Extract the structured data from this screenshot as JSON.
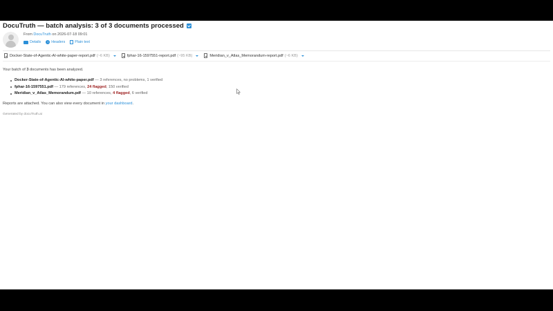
{
  "email": {
    "subject": "DocuTruth — batch analysis: 3 of 3 documents processed",
    "from_prefix": "From",
    "sender": "DocuTruth",
    "date_text": "on 2026-07-18 09:01",
    "meta_links": {
      "details": "Details",
      "headers": "Headers",
      "plain_text": "Plain text"
    },
    "attachments": [
      {
        "name": "Docker-State-of-Agentic-AI-white-paper-report.pdf",
        "size": "(~6 KB)"
      },
      {
        "name": "fphar-16-1597551-report.pdf",
        "size": "(~95 KB)"
      },
      {
        "name": "Meridian_v_Atlas_Memorandum-report.pdf",
        "size": "(~6 KB)"
      }
    ],
    "intro_pre": "Your batch of",
    "intro_count": "3",
    "intro_post": "documents has been analyzed.",
    "results": [
      {
        "file": "Docker-State-of-Agentic-AI-white-paper.pdf",
        "summary": "— 3 references, no problems, 1 verified",
        "flagged": "",
        "after": ""
      },
      {
        "file": "fphar-16-1597551.pdf",
        "summary": "— 179 references,",
        "flagged": "24 flagged",
        "after": ", 150 verified"
      },
      {
        "file": "Meridian_v_Atlas_Memorandum.pdf",
        "summary": "— 10 references,",
        "flagged": "4 flagged",
        "after": ", 6 verified"
      }
    ],
    "reports_pre": "Reports are attached. You can also view every document in",
    "dashboard_link": "your dashboard",
    "reports_post": ".",
    "generated_by": "Generated by docuTruth.ai"
  },
  "colors": {
    "link": "#2b8fd8",
    "flagged": "#9b1c1c"
  },
  "icons": {
    "flag": "checkbox-icon",
    "mail": "envelope-icon",
    "info": "info-icon",
    "doc": "document-icon",
    "file": "pdf-file-icon",
    "caret": "chevron-down-icon",
    "cursor": "mouse-cursor-icon"
  }
}
